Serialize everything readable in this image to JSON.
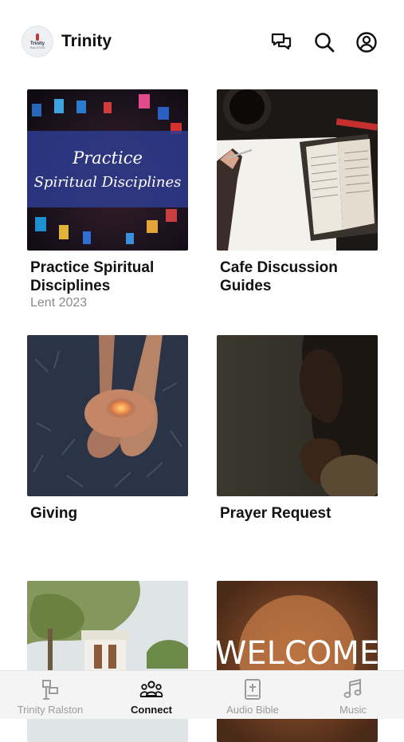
{
  "status": {
    "time": ""
  },
  "header": {
    "title": "Trinity",
    "logo_text": "Trinity",
    "logo_sub": "RALSTON",
    "icons": [
      "chat-icon",
      "search-icon",
      "profile-icon"
    ]
  },
  "cards": [
    {
      "title": "Practice Spiritual Disciplines",
      "subtitle": "Lent 2023",
      "image_text_line1": "Practice",
      "image_text_line2": "Spiritual Disciplines"
    },
    {
      "title": "Cafe Discussion Guides",
      "subtitle": ""
    },
    {
      "title": "Giving",
      "subtitle": ""
    },
    {
      "title": "Prayer Request",
      "subtitle": ""
    },
    {
      "title": "",
      "subtitle": ""
    },
    {
      "title": "",
      "subtitle": "",
      "image_text": "WELCOME"
    }
  ],
  "tabbar": {
    "tabs": [
      {
        "label": "Trinity Ralston",
        "icon": "signpost-icon",
        "active": false
      },
      {
        "label": "Connect",
        "icon": "people-icon",
        "active": true
      },
      {
        "label": "Audio Bible",
        "icon": "bible-icon",
        "active": false
      },
      {
        "label": "Music",
        "icon": "music-note-icon",
        "active": false
      }
    ]
  },
  "colors": {
    "accent": "#111111",
    "inactive": "#9b9b9f",
    "tabbar_bg": "#f4f4f5"
  }
}
